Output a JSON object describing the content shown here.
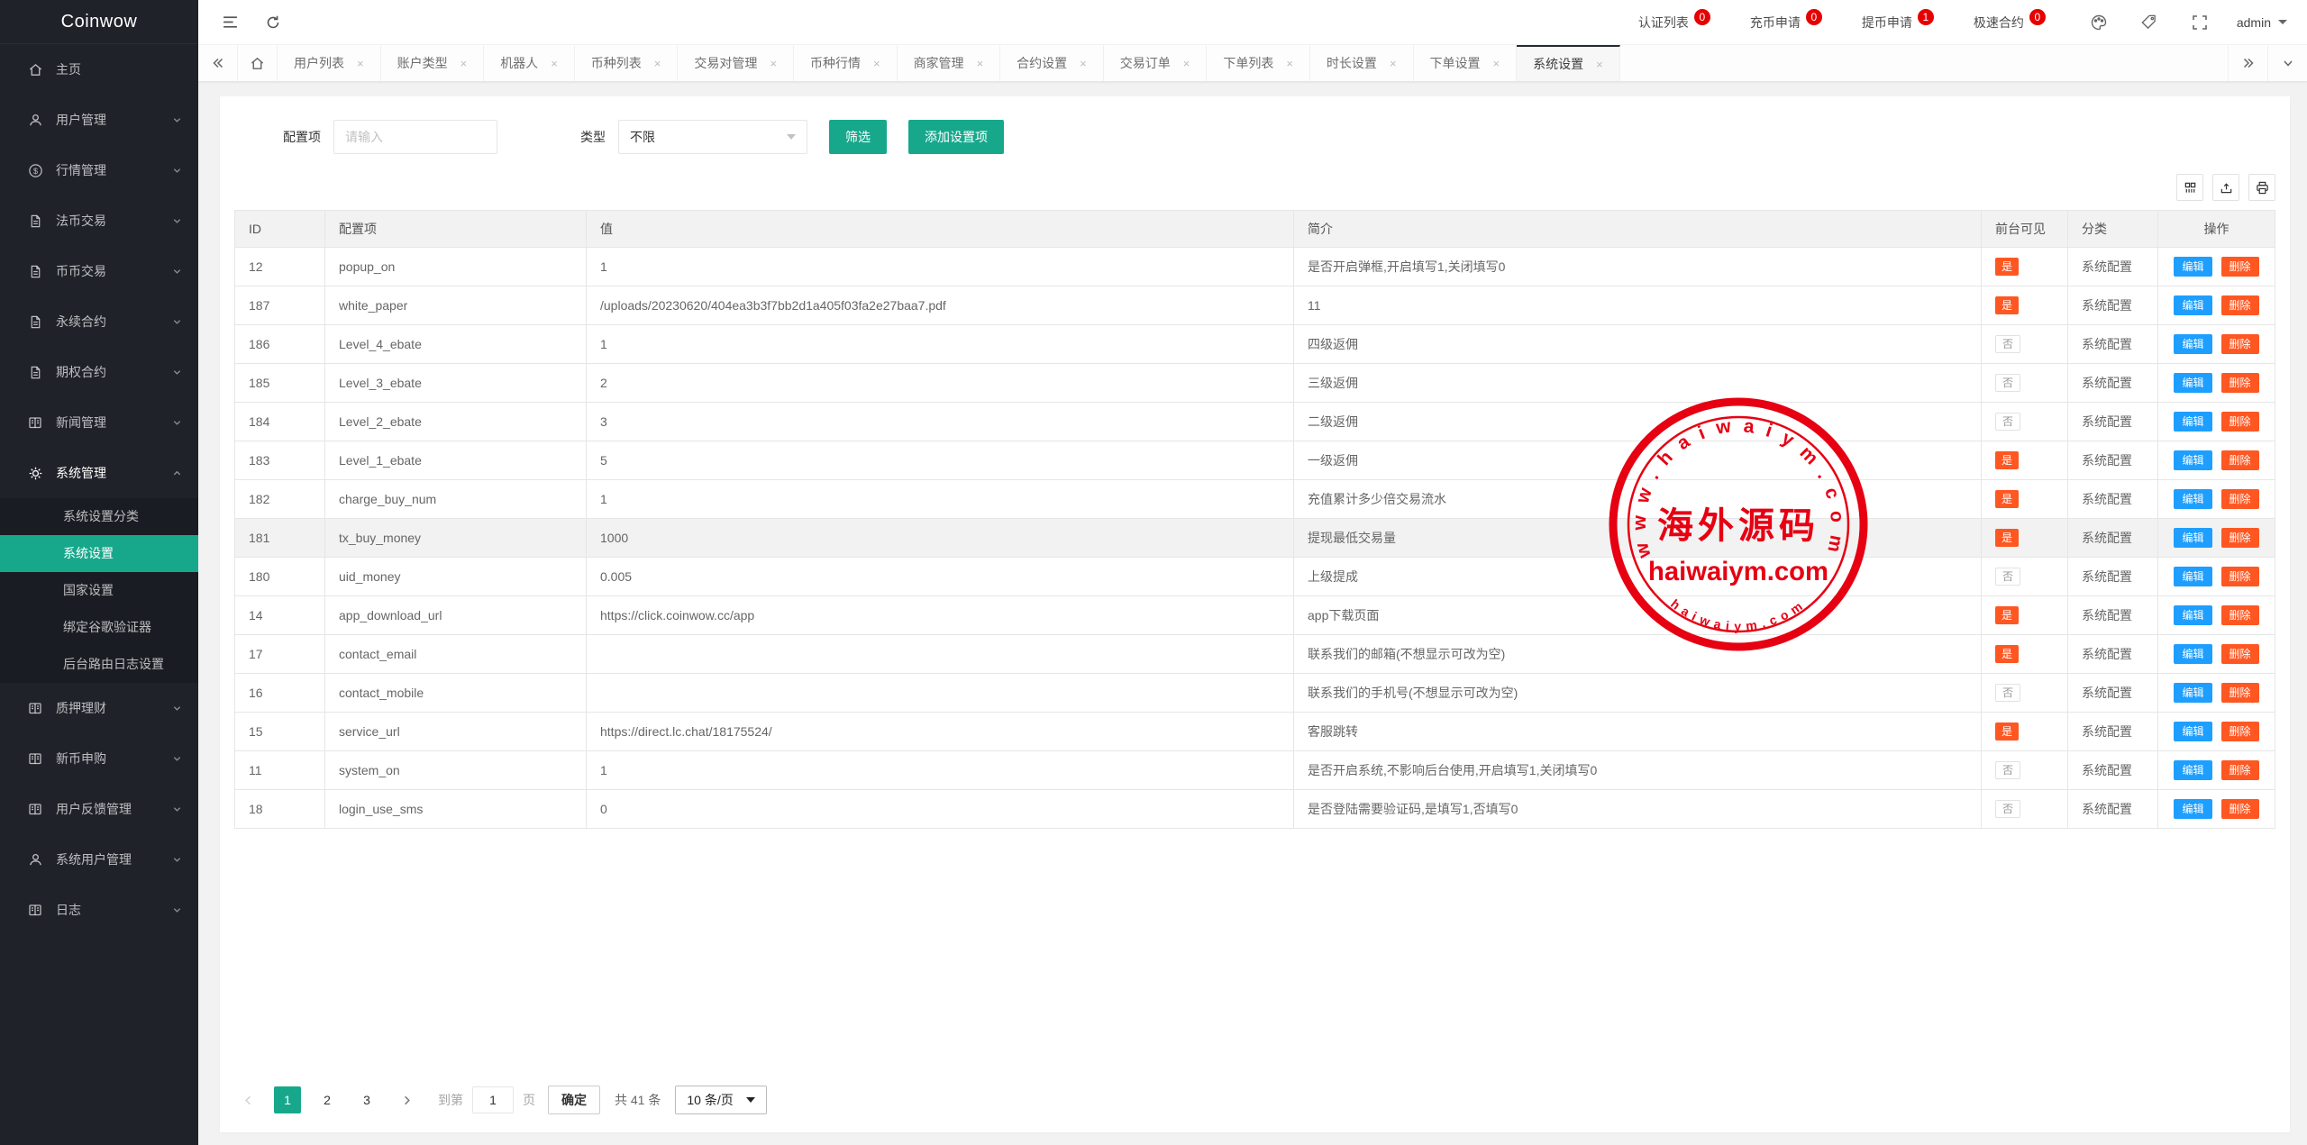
{
  "app": {
    "logo": "Coinwow"
  },
  "colors": {
    "accent": "#17a88c",
    "badge_red": "#e60000",
    "yes_orange": "#ff5722",
    "edit_blue": "#1e9fff",
    "delete_orange": "#ff5722",
    "sidebar_bg": "#20222A",
    "stamp_red": "#e60012"
  },
  "header": {
    "shortcuts": [
      {
        "id": "auth-list",
        "label": "认证列表",
        "count": "0"
      },
      {
        "id": "deposit-request",
        "label": "充币申请",
        "count": "0"
      },
      {
        "id": "withdraw-request",
        "label": "提币申请",
        "count": "1"
      },
      {
        "id": "fast-contract",
        "label": "极速合约",
        "count": "0"
      }
    ],
    "user": "admin"
  },
  "sidebar": {
    "items": [
      {
        "id": "home",
        "label": "主页",
        "icon": "home-icon",
        "expandable": false
      },
      {
        "id": "user-mgmt",
        "label": "用户管理",
        "icon": "user-icon",
        "expandable": true
      },
      {
        "id": "market-mgmt",
        "label": "行情管理",
        "icon": "dollar-icon",
        "expandable": true
      },
      {
        "id": "fiat-trade",
        "label": "法币交易",
        "icon": "file-icon",
        "expandable": true
      },
      {
        "id": "coin-trade",
        "label": "币币交易",
        "icon": "file-icon",
        "expandable": true
      },
      {
        "id": "perpetual-contract",
        "label": "永续合约",
        "icon": "file-icon",
        "expandable": true
      },
      {
        "id": "option-contract",
        "label": "期权合约",
        "icon": "file-icon",
        "expandable": true
      },
      {
        "id": "news-mgmt",
        "label": "新闻管理",
        "icon": "news-icon",
        "expandable": true
      },
      {
        "id": "system-mgmt",
        "label": "系统管理",
        "icon": "gear-icon",
        "expandable": true,
        "expanded": true,
        "children": [
          {
            "id": "system-setting-category",
            "label": "系统设置分类",
            "active": false
          },
          {
            "id": "system-settings",
            "label": "系统设置",
            "active": true
          },
          {
            "id": "country-settings",
            "label": "国家设置",
            "active": false
          },
          {
            "id": "bind-google-auth",
            "label": "绑定谷歌验证器",
            "active": false
          },
          {
            "id": "backend-route-log",
            "label": "后台路由日志设置",
            "active": false
          }
        ]
      },
      {
        "id": "staking-finance",
        "label": "质押理财",
        "icon": "news-icon",
        "expandable": true
      },
      {
        "id": "new-coin-subscribe",
        "label": "新币申购",
        "icon": "news-icon",
        "expandable": true
      },
      {
        "id": "user-feedback-mgmt",
        "label": "用户反馈管理",
        "icon": "news-icon",
        "expandable": true
      },
      {
        "id": "system-user-mgmt",
        "label": "系统用户管理",
        "icon": "user-icon",
        "expandable": true
      },
      {
        "id": "logs",
        "label": "日志",
        "icon": "news-icon",
        "expandable": true
      }
    ]
  },
  "tabbar": {
    "tabs": [
      "用户列表",
      "账户类型",
      "机器人",
      "币种列表",
      "交易对管理",
      "币种行情",
      "商家管理",
      "合约设置",
      "交易订单",
      "下单列表",
      "时长设置",
      "下单设置",
      "系统设置"
    ],
    "active": "系统设置"
  },
  "filter": {
    "config_label": "配置项",
    "config_placeholder": "请输入",
    "type_label": "类型",
    "type_value": "不限",
    "filter_button": "筛选",
    "add_button": "添加设置项"
  },
  "table": {
    "columns": [
      "ID",
      "配置项",
      "值",
      "简介",
      "前台可见",
      "分类",
      "操作"
    ],
    "edit_label": "编辑",
    "delete_label": "删除",
    "rows": [
      {
        "id": "12",
        "key": "popup_on",
        "value": "1",
        "desc": "是否开启弹框,开启填写1,关闭填写0",
        "visible": "是",
        "category": "系统配置",
        "highlight": false
      },
      {
        "id": "187",
        "key": "white_paper",
        "value": "/uploads/20230620/404ea3b3f7bb2d1a405f03fa2e27baa7.pdf",
        "desc": "11",
        "visible": "是",
        "category": "系统配置",
        "highlight": false
      },
      {
        "id": "186",
        "key": "Level_4_ebate",
        "value": "1",
        "desc": "四级返佣",
        "visible": "否",
        "category": "系统配置",
        "highlight": false
      },
      {
        "id": "185",
        "key": "Level_3_ebate",
        "value": "2",
        "desc": "三级返佣",
        "visible": "否",
        "category": "系统配置",
        "highlight": false
      },
      {
        "id": "184",
        "key": "Level_2_ebate",
        "value": "3",
        "desc": "二级返佣",
        "visible": "否",
        "category": "系统配置",
        "highlight": false
      },
      {
        "id": "183",
        "key": "Level_1_ebate",
        "value": "5",
        "desc": "一级返佣",
        "visible": "是",
        "category": "系统配置",
        "highlight": false
      },
      {
        "id": "182",
        "key": "charge_buy_num",
        "value": "1",
        "desc": "充值累计多少倍交易流水",
        "visible": "是",
        "category": "系统配置",
        "highlight": false
      },
      {
        "id": "181",
        "key": "tx_buy_money",
        "value": "1000",
        "desc": "提现最低交易量",
        "visible": "是",
        "category": "系统配置",
        "highlight": true
      },
      {
        "id": "180",
        "key": "uid_money",
        "value": "0.005",
        "desc": "上级提成",
        "visible": "否",
        "category": "系统配置",
        "highlight": false
      },
      {
        "id": "14",
        "key": "app_download_url",
        "value": "https://click.coinwow.cc/app",
        "desc": "app下载页面",
        "visible": "是",
        "category": "系统配置",
        "highlight": false
      },
      {
        "id": "17",
        "key": "contact_email",
        "value": "",
        "desc": "联系我们的邮箱(不想显示可改为空)",
        "visible": "是",
        "category": "系统配置",
        "highlight": false
      },
      {
        "id": "16",
        "key": "contact_mobile",
        "value": "",
        "desc": "联系我们的手机号(不想显示可改为空)",
        "visible": "否",
        "category": "系统配置",
        "highlight": false
      },
      {
        "id": "15",
        "key": "service_url",
        "value": "https://direct.lc.chat/18175524/",
        "desc": "客服跳转",
        "visible": "是",
        "category": "系统配置",
        "highlight": false
      },
      {
        "id": "11",
        "key": "system_on",
        "value": "1",
        "desc": "是否开启系统,不影响后台使用,开启填写1,关闭填写0",
        "visible": "否",
        "category": "系统配置",
        "highlight": false
      },
      {
        "id": "18",
        "key": "login_use_sms",
        "value": "0",
        "desc": "是否登陆需要验证码,是填写1,否填写0",
        "visible": "否",
        "category": "系统配置",
        "highlight": false
      }
    ]
  },
  "pagination": {
    "pages": [
      "1",
      "2",
      "3"
    ],
    "active_page": "1",
    "goto_label": "到第",
    "page_input": "1",
    "page_unit": "页",
    "confirm_label": "确定",
    "total_label": "共 41 条",
    "page_size_label": "10 条/页"
  },
  "watermark": {
    "top_text": "www.haiwaiym.com",
    "center_text": "海外源码",
    "mid_text": "haiwaiym.com",
    "bottom_text": "haiwaiym.com"
  }
}
